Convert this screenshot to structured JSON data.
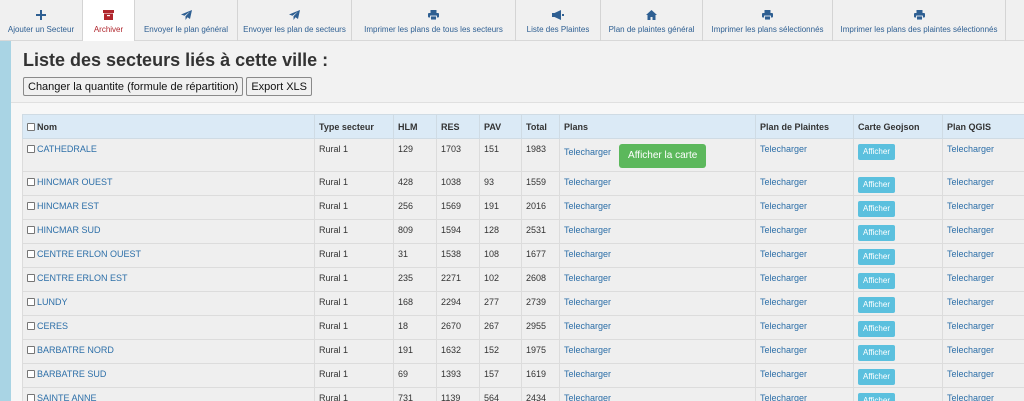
{
  "toolbar": {
    "items": [
      {
        "name": "ajouter-secteur-button",
        "icon": "plus-icon",
        "label": "Ajouter un Secteur",
        "width": 83,
        "active": false
      },
      {
        "name": "archiver-button",
        "icon": "archive-icon",
        "label": "Archiver",
        "width": 52,
        "active": true
      },
      {
        "name": "envoyer-plan-general-button",
        "icon": "send-icon",
        "label": "Envoyer le plan général",
        "width": 103,
        "active": false
      },
      {
        "name": "envoyer-plans-secteurs-button",
        "icon": "send-icon",
        "label": "Envoyer les plan de secteurs",
        "width": 114,
        "active": false
      },
      {
        "name": "imprimer-plans-tous-secteurs-button",
        "icon": "print-icon",
        "label": "Imprimer les plans de tous les secteurs",
        "width": 164,
        "active": false
      },
      {
        "name": "liste-plaintes-button",
        "icon": "bullhorn-icon",
        "label": "Liste des Plaintes",
        "width": 85,
        "active": false
      },
      {
        "name": "plan-plaintes-general-button",
        "icon": "home-icon",
        "label": "Plan de plaintes général",
        "width": 102,
        "active": false
      },
      {
        "name": "imprimer-plans-selectionnes-button",
        "icon": "print-icon",
        "label": "Imprimer les plans sélectionnés",
        "width": 130,
        "active": false
      },
      {
        "name": "imprimer-plans-plaintes-selectionnes-button",
        "icon": "print-icon",
        "label": "Imprimer les plans des plaintes sélectionnés",
        "width": 173,
        "active": false
      }
    ]
  },
  "page": {
    "title": "Liste des secteurs liés à cette ville :",
    "change_qty_label": "Changer la quantite (formule de répartition)",
    "export_label": "Export XLS"
  },
  "table": {
    "headers": {
      "nom": "Nom",
      "type": "Type secteur",
      "hlm": "HLM",
      "res": "RES",
      "pav": "PAV",
      "total": "Total",
      "plans": "Plans",
      "plan_plaintes": "Plan de Plaintes",
      "carte": "Carte Geojson",
      "qgis": "Plan QGIS"
    },
    "download_label": "Telecharger",
    "show_map_label": "Afficher la carte",
    "show_label": "Afficher",
    "rows": [
      {
        "nom": "CATHEDRALE",
        "type": "Rural 1",
        "hlm": "129",
        "res": "1703",
        "pav": "151",
        "total": "1983"
      },
      {
        "nom": "HINCMAR OUEST",
        "type": "Rural 1",
        "hlm": "428",
        "res": "1038",
        "pav": "93",
        "total": "1559"
      },
      {
        "nom": "HINCMAR EST",
        "type": "Rural 1",
        "hlm": "256",
        "res": "1569",
        "pav": "191",
        "total": "2016"
      },
      {
        "nom": "HINCMAR SUD",
        "type": "Rural 1",
        "hlm": "809",
        "res": "1594",
        "pav": "128",
        "total": "2531"
      },
      {
        "nom": "CENTRE ERLON OUEST",
        "type": "Rural 1",
        "hlm": "31",
        "res": "1538",
        "pav": "108",
        "total": "1677"
      },
      {
        "nom": "CENTRE ERLON EST",
        "type": "Rural 1",
        "hlm": "235",
        "res": "2271",
        "pav": "102",
        "total": "2608"
      },
      {
        "nom": "LUNDY",
        "type": "Rural 1",
        "hlm": "168",
        "res": "2294",
        "pav": "277",
        "total": "2739"
      },
      {
        "nom": "CERES",
        "type": "Rural 1",
        "hlm": "18",
        "res": "2670",
        "pav": "267",
        "total": "2955"
      },
      {
        "nom": "BARBATRE NORD",
        "type": "Rural 1",
        "hlm": "191",
        "res": "1632",
        "pav": "152",
        "total": "1975"
      },
      {
        "nom": "BARBATRE SUD",
        "type": "Rural 1",
        "hlm": "69",
        "res": "1393",
        "pav": "157",
        "total": "1619"
      },
      {
        "nom": "SAINTE ANNE",
        "type": "Rural 1",
        "hlm": "731",
        "res": "1139",
        "pav": "564",
        "total": "2434"
      }
    ]
  },
  "colors": {
    "toolbar_link": "#2e5f92",
    "active_red": "#b0262d",
    "map_button": "#5cb85c",
    "afficher_button": "#5bc0de"
  }
}
